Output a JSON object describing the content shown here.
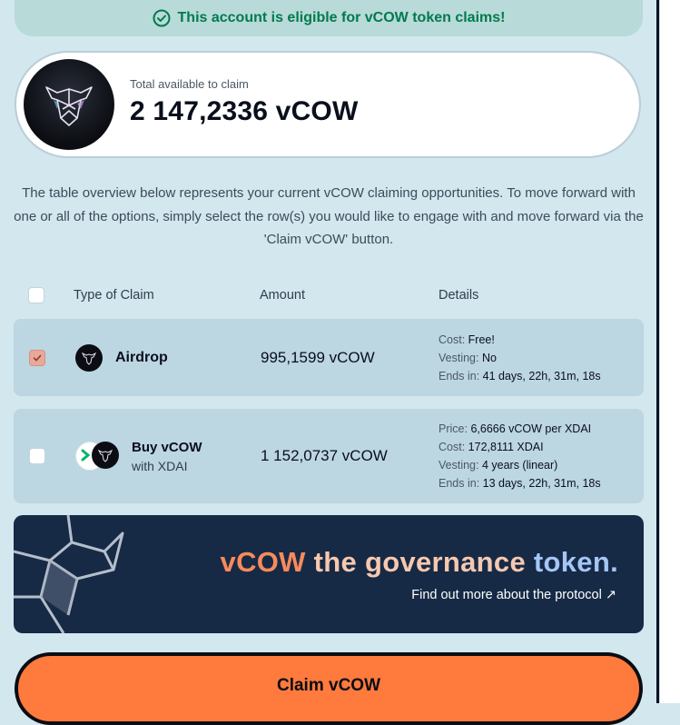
{
  "banner": {
    "text": "This account is eligible for vCOW token claims!",
    "color": "#007a4d"
  },
  "total": {
    "label": "Total available to claim",
    "value": "2 147,2336 vCOW"
  },
  "intro": "The table overview below represents your current vCOW claiming opportunities. To move forward with one or all of the options, simply select the row(s) you would like to engage with and move forward via the 'Claim vCOW' button.",
  "table": {
    "headers": {
      "type": "Type of Claim",
      "amount": "Amount",
      "details": "Details"
    },
    "rows": [
      {
        "name": "Airdrop",
        "sub": "",
        "selected": true,
        "amount": "995,1599 vCOW",
        "details": [
          {
            "k": "Cost:",
            "v": "Free!"
          },
          {
            "k": "Vesting:",
            "v": "No"
          },
          {
            "k": "Ends in:",
            "v": "41 days, 22h, 31m, 18s"
          }
        ]
      },
      {
        "name": "Buy vCOW",
        "sub": "with XDAI",
        "selected": false,
        "amount": "1 152,0737 vCOW",
        "details": [
          {
            "k": "Price:",
            "v": "6,6666 vCOW per XDAI"
          },
          {
            "k": "Cost:",
            "v": "172,8111 XDAI"
          },
          {
            "k": "Vesting:",
            "v": "4 years (linear)"
          },
          {
            "k": "Ends in:",
            "v": "13 days, 22h, 31m, 18s"
          }
        ]
      }
    ]
  },
  "governance": {
    "title_part1": "vCOW",
    "title_part2": "the governance",
    "title_part3": "token.",
    "link": "Find out more about the protocol ↗"
  },
  "claim_button": "Claim vCOW",
  "colors": {
    "accent": "#ff7a3d",
    "background": "#d3e7ee",
    "banner_bg": "#162a45"
  },
  "icons": [
    "check-circle-icon",
    "cow-logo-icon",
    "xdai-icon",
    "external-link-icon"
  ]
}
